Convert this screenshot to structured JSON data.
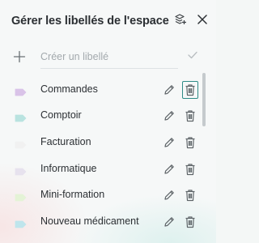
{
  "dialog": {
    "title": "Gérer les libellés de l'espace"
  },
  "header_icons": {
    "layers": "layers-add-icon",
    "close": "close-icon"
  },
  "create": {
    "placeholder": "Créer un libellé",
    "value": ""
  },
  "labels": [
    {
      "name": "Commandes",
      "color": "#d9c3e8"
    },
    {
      "name": "Comptoir",
      "color": "#b9e3e0"
    },
    {
      "name": "Facturation",
      "color": "#f1f1f1"
    },
    {
      "name": "Informatique",
      "color": "#e7e2ee"
    },
    {
      "name": "Mini-formation",
      "color": "#e4f3d6"
    },
    {
      "name": "Nouveau médicament",
      "color": "#bfe5ec"
    }
  ],
  "colors": {
    "accent": "#2e8b86",
    "icon": "#5f6569"
  }
}
